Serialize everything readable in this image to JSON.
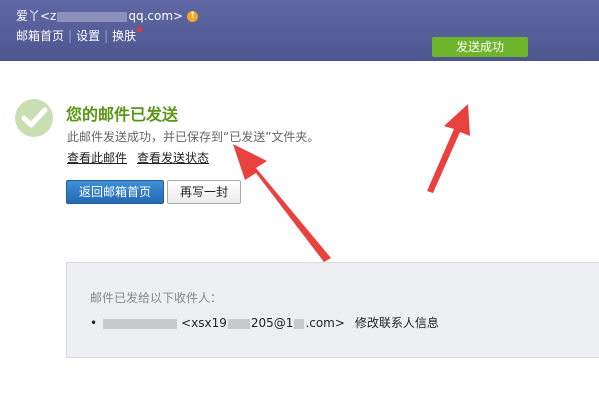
{
  "header": {
    "account_prefix": "爱丫<z",
    "account_suffix": "qq.com>",
    "warning_icon": "!",
    "nav": {
      "home": "邮箱首页",
      "settings": "设置",
      "skin": "换肤"
    },
    "sent_badge": "发送成功"
  },
  "main": {
    "title": "您的邮件已发送",
    "description": "此邮件发送成功，并已保存到“已发送”文件夹。",
    "links": {
      "view_mail": "查看此邮件",
      "view_status": "查看发送状态"
    },
    "buttons": {
      "back_home": "返回邮箱首页",
      "write_again": "再写一封"
    }
  },
  "recipients_panel": {
    "label": "邮件已发给以下收件人：",
    "recipient": {
      "bullet": "•",
      "address": "<xsx19",
      "address_tail": "205@1",
      "address_end": ".com>",
      "edit_link": "修改联系人信息"
    }
  },
  "colors": {
    "header_bg": "#5f68a4",
    "success_green": "#6fb52c",
    "title_green": "#5a9616",
    "primary_button": "#2f7fc7",
    "annotation_red": "#e8423f"
  }
}
